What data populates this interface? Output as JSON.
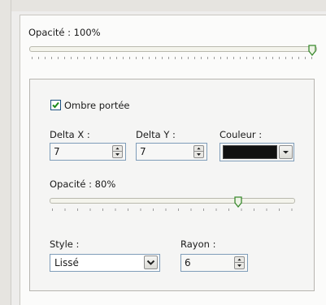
{
  "opacity_main": {
    "label": "Opacité : 100%",
    "value": 1.0
  },
  "shadow": {
    "checkbox_label": "Ombre portée",
    "checked": true,
    "delta_x": {
      "label": "Delta X :",
      "value": "7"
    },
    "delta_y": {
      "label": "Delta Y :",
      "value": "7"
    },
    "color": {
      "label": "Couleur :",
      "value": "#111111"
    },
    "opacity": {
      "label": "Opacité : 80%",
      "value": 0.8
    },
    "style": {
      "label": "Style :",
      "value": "Lissé"
    },
    "radius": {
      "label": "Rayon :",
      "value": "6"
    }
  },
  "colors": {
    "accent_check": "#1a8a1a",
    "thumb": "#3a8a2e"
  }
}
